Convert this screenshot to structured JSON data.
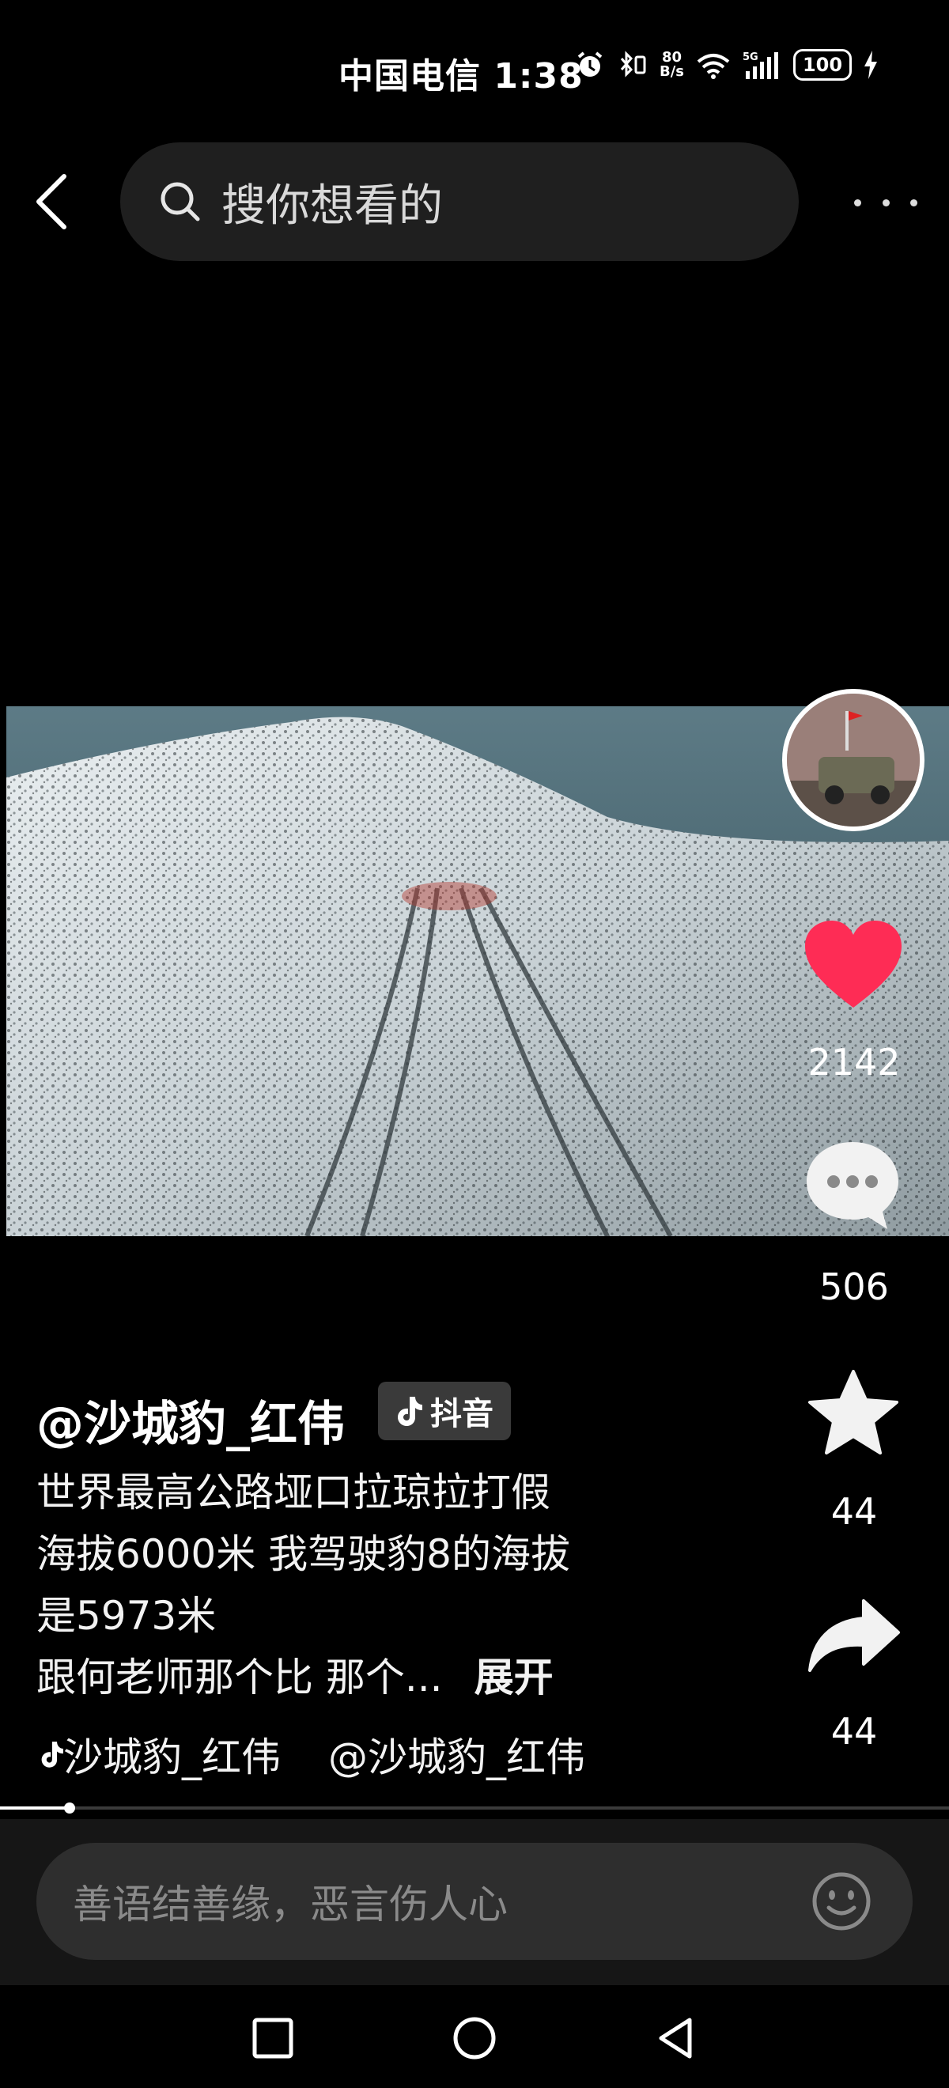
{
  "status_bar": {
    "carrier_time": "中国电信 1:38",
    "net_speed_top": "80",
    "net_speed_bottom": "B/s",
    "network": "5G",
    "battery": "100"
  },
  "search": {
    "placeholder": "搜你想看的"
  },
  "video": {
    "author": "@沙城豹_红伟",
    "app_badge": "抖音",
    "description_lines": [
      "世界最高公路垭口拉琼拉打假",
      "海拔6000米 我驾驶豹8的海拔",
      "是5973米",
      "跟何老师那个比 那个..."
    ],
    "expand_label": "展开",
    "tags": [
      "沙城豹_红伟",
      "@沙城豹_红伟"
    ],
    "progress_fraction": 0.073
  },
  "actions": {
    "likes": "2142",
    "comments": "506",
    "favorites": "44",
    "shares": "44"
  },
  "comment_box": {
    "placeholder": "善语结善缘，恶言伤人心"
  },
  "colors": {
    "like_red": "#fe2c55",
    "background": "#000000",
    "search_bg": "#1f1f1f"
  }
}
